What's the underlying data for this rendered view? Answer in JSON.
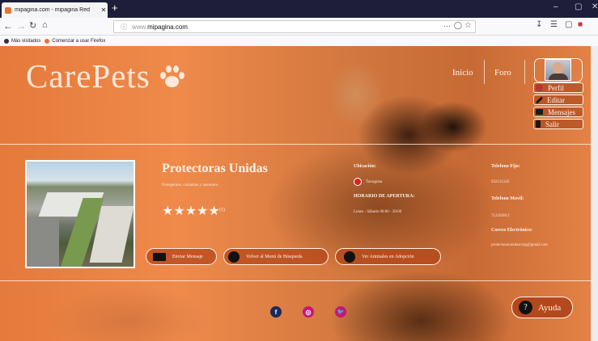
{
  "browser": {
    "tab_title": "mipagina.com - mipagina Red",
    "tab_close": "✕",
    "new_tab": "+",
    "window_controls": [
      "–",
      "▢",
      "✕"
    ],
    "url_host": "www.",
    "url_domain": "mipagina.com",
    "bookmarks": [
      "Más visitados",
      "Comenzar a usar Firefox"
    ]
  },
  "header": {
    "brand": "CarePets",
    "nav": [
      "Inicio",
      "Foro"
    ],
    "user_menu": [
      "Perfil",
      "Editar",
      "Mensajes",
      "Salir"
    ]
  },
  "organization": {
    "name": "Protectoras Unidas",
    "description": "Protegemos, cuidamos y queremos",
    "stars": "★★★★★",
    "rating_count": "(5)",
    "location_label": "Ubicación:",
    "location": "Tarragona",
    "hours_label": "HORARIO DE APERTURA:",
    "hours": "Lunes - Sábado   06:00 - 20:00",
    "phone_label": "Telefono Fijo:",
    "phone": "932131245",
    "mobile_label": "Telefono Movil:",
    "mobile": "712450913",
    "email_label": "Correo Electrónico:",
    "email": "protectorasunidascorg@gmail.com"
  },
  "actions": {
    "send_message": "Enviar Mensaje",
    "back_to_search": "Volver al Menú de Búsqueda",
    "view_animals": "Ver Animales en Adopción"
  },
  "footer": {
    "social": [
      "f",
      "◎",
      "🐦"
    ],
    "help": "Ayuda",
    "help_icon": "?"
  },
  "colors": {
    "accent": "#e47a3c",
    "facebook": "#1b2a5a",
    "instagram": "#c2187a",
    "twitter": "#c2187a"
  }
}
